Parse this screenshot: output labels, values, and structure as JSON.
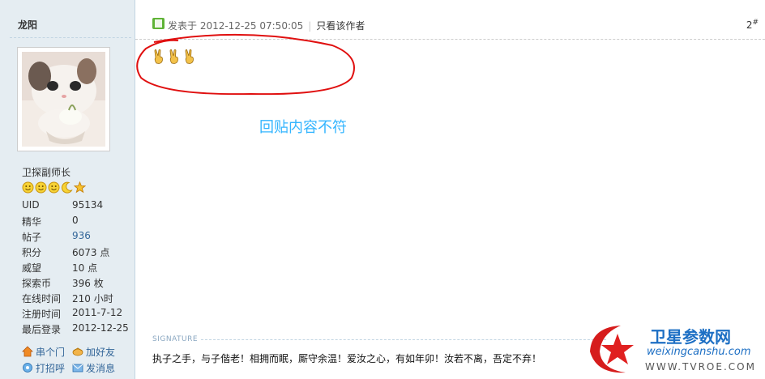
{
  "user": {
    "name": "龙阳",
    "title": "卫探副师长",
    "stats": [
      {
        "key": "UID",
        "value": "95134"
      },
      {
        "key": "精华",
        "value": "0"
      },
      {
        "key": "帖子",
        "value": "936"
      },
      {
        "key": "积分",
        "value": "6073 点"
      },
      {
        "key": "威望",
        "value": "10 点"
      },
      {
        "key": "探索币",
        "value": "396 枚"
      },
      {
        "key": "在线时间",
        "value": "210 小时"
      },
      {
        "key": "注册时间",
        "value": "2011-7-12"
      },
      {
        "key": "最后登录",
        "value": "2012-12-25"
      }
    ],
    "rank_icons": [
      "smiley-icon",
      "smiley-icon",
      "smiley-icon",
      "moon-icon",
      "star-icon"
    ]
  },
  "actions": {
    "visit": "串个门",
    "add_friend": "加好友",
    "greet": "打招呼",
    "message": "发消息"
  },
  "post": {
    "posted_at": "发表于 2012-12-25 07:50:05",
    "only_author": "只看该作者",
    "floor": "2",
    "floor_suffix": "#",
    "content_icons": [
      "victory-hand-icon",
      "victory-hand-icon",
      "victory-hand-icon"
    ]
  },
  "annotation": "回贴内容不符",
  "signature": {
    "label": "SIGNATURE",
    "text": "执子之手，与子偕老！相拥而眠，厮守余温！爱汝之心，有如年卯！汝若不离，吾定不弃！"
  },
  "watermark": {
    "title": "卫星参数网",
    "url": "weixingcanshu.com",
    "url2": "WWW.TVROE.COM"
  },
  "colors": {
    "sidebar_bg": "#e5edf2",
    "link": "#336699",
    "annotation": "#33b5ff",
    "circle": "#e01010"
  }
}
